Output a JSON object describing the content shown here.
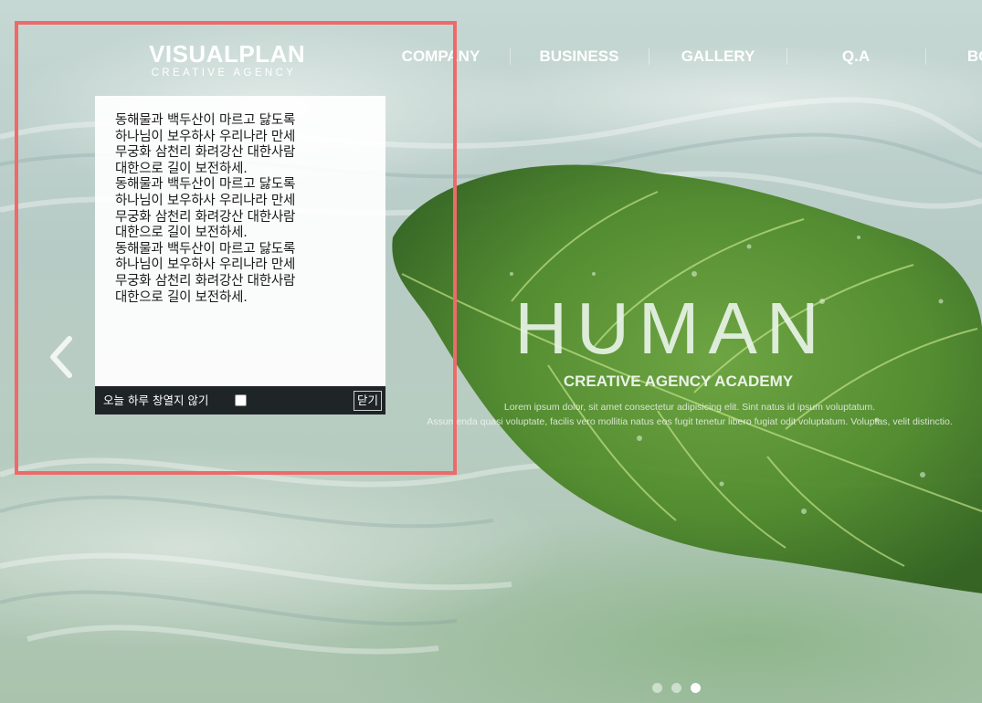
{
  "logo": {
    "title": "VISUALPLAN",
    "subtitle": "CREATIVE AGENCY"
  },
  "nav": {
    "items": [
      "COMPANY",
      "BUSINESS",
      "GALLERY",
      "Q.A",
      "BOARD"
    ]
  },
  "hero": {
    "title": "HUMAN",
    "subtitle": "CREATIVE AGENCY ACADEMY",
    "desc_line1": "Lorem ipsum dolor, sit amet consectetur adipisicing elit. Sint natus id ipsum voluptatum.",
    "desc_line2": "Assumenda quasi voluptate, facilis vero mollitia natus eos fugit tenetur libero fugiat odit voluptatum. Voluptas, velit distinctio."
  },
  "popup": {
    "body": "동해물과 백두산이 마르고 닳도록\n하나님이 보우하사 우리나라 만세\n무궁화 삼천리 화려강산 대한사람\n대한으로 길이 보전하세.\n동해물과 백두산이 마르고 닳도록\n하나님이 보우하사 우리나라 만세\n무궁화 삼천리 화려강산 대한사람\n대한으로 길이 보전하세.\n동해물과 백두산이 마르고 닳도록\n하나님이 보우하사 우리나라 만세\n무궁화 삼천리 화려강산 대한사람\n대한으로 길이 보전하세.",
    "dont_show_today": "오늘 하루 창열지 않기",
    "dont_show_checked": false,
    "close_label": "닫기"
  },
  "slider": {
    "total_slides": 3,
    "active_slide": 3
  },
  "icons": {
    "prev": "chevron-left-icon"
  },
  "colors": {
    "highlight": "#ee6a6a",
    "popup_footer": "#1f2426"
  }
}
